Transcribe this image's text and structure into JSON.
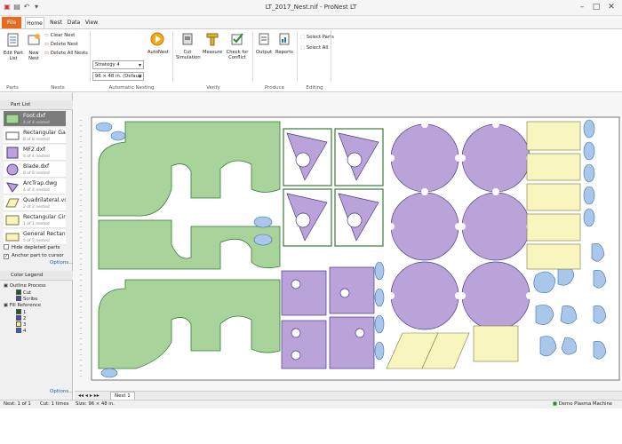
{
  "title": "LT_2017_Nest.nif - ProNest LT",
  "tabs": [
    "File",
    "Home",
    "Nest",
    "Data",
    "View"
  ],
  "ribbon": {
    "edit_part_list": "Edit Part List",
    "new_nest": "New Nest",
    "clear_nest": "Clear Nest",
    "delete_nest": "Delete Nest",
    "delete_all_nests": "Delete All Nests",
    "strategy": "Strategy 4",
    "sheet": "96 × 48 in. (Default",
    "autonest": "AutoNest",
    "cut_simulation": "Cut Simulation",
    "measure": "Measure",
    "check_conflict": "Check for Conflict",
    "output": "Output",
    "reports": "Reports",
    "select_parts": "Select Parts",
    "select_all": "Select All",
    "groups": [
      "Parts",
      "Nests",
      "Automatic Nesting",
      "Verify",
      "Produce",
      "Editing"
    ]
  },
  "part_list": {
    "header": "Part List",
    "items": [
      {
        "name": "Foot.dxf",
        "count": "4 of 4 nested"
      },
      {
        "name": "Rectangular Ga",
        "count": "8 of 8 nested"
      },
      {
        "name": "MF2.dxf",
        "count": "4 of 4 nested"
      },
      {
        "name": "Blade.dxf",
        "count": "8 of 8 nested"
      },
      {
        "name": "ArcTrap.dwg",
        "count": "4 of 4 nested"
      },
      {
        "name": "Quadrilateral.vs",
        "count": "2 of 2 nested"
      },
      {
        "name": "Rectangular Cir",
        "count": "1 of 1 nested"
      },
      {
        "name": "General Rectan",
        "count": "5 of 5 nested"
      }
    ],
    "hide_depleted": "Hide depleted parts",
    "anchor": "Anchor part to cursor",
    "options": "Options..."
  },
  "legend": {
    "header": "Color Legend",
    "outline_process": "Outline Process",
    "cut": "Cut",
    "scribe": "Scribe",
    "fill_reference": "Fill Reference",
    "fills": [
      "1",
      "2",
      "3",
      "4"
    ],
    "fill_colors": [
      "#1f5c1f",
      "#4a4ab4",
      "#f5f08a",
      "#2f5fd0"
    ],
    "options": "Options..."
  },
  "nest_tabs": {
    "current": "Nest 1"
  },
  "status": {
    "nest": "Nest: 1 of 1",
    "cut": "Cut: 1 times",
    "size": "Size: 96 × 48 in.",
    "machine": "Demo Plasma Machine"
  },
  "colors": {
    "green": "#a8d39a",
    "purple": "#b9a3d9",
    "yellow": "#f8f5bf",
    "blue": "#a9c7ea",
    "outline": "#2f7d2f"
  }
}
